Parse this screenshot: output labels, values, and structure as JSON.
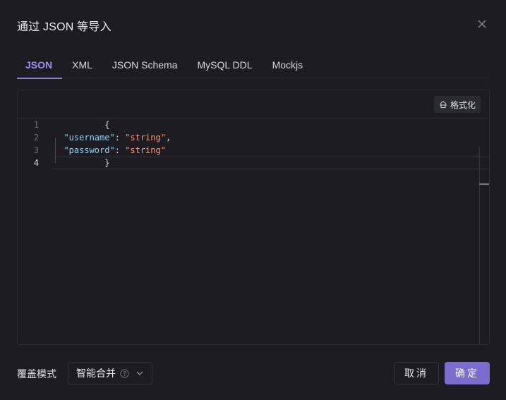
{
  "dialog": {
    "title": "通过 JSON 等导入",
    "close_icon": "close-icon"
  },
  "tabs": [
    {
      "label": "JSON",
      "active": true
    },
    {
      "label": "XML",
      "active": false
    },
    {
      "label": "JSON Schema",
      "active": false
    },
    {
      "label": "MySQL DDL",
      "active": false
    },
    {
      "label": "Mockjs",
      "active": false
    }
  ],
  "editor": {
    "format_button": {
      "label": "格式化",
      "icon": "format-icon"
    },
    "lines": [
      {
        "number": "1",
        "tokens": [
          {
            "t": "punct",
            "v": "{"
          }
        ]
      },
      {
        "number": "2",
        "tokens": [
          {
            "t": "punct",
            "v": "  "
          },
          {
            "t": "key",
            "v": "\"username\""
          },
          {
            "t": "punct",
            "v": ": "
          },
          {
            "t": "str",
            "v": "\"string\""
          },
          {
            "t": "punct",
            "v": ","
          }
        ]
      },
      {
        "number": "3",
        "tokens": [
          {
            "t": "punct",
            "v": "  "
          },
          {
            "t": "key",
            "v": "\"password\""
          },
          {
            "t": "punct",
            "v": ": "
          },
          {
            "t": "str",
            "v": "\"string\""
          }
        ]
      },
      {
        "number": "4",
        "tokens": [
          {
            "t": "punct",
            "v": "}"
          }
        ]
      }
    ],
    "current_line": "4"
  },
  "footer": {
    "mode_label": "覆盖模式",
    "mode_select": {
      "value": "智能合并",
      "help_icon": "help-circle-icon",
      "chevron_icon": "chevron-down-icon"
    },
    "cancel_label": "取消",
    "confirm_label": "确定"
  },
  "colors": {
    "accent": "#7b6cd0",
    "active_tab": "#a08fe8",
    "background": "#1c1c22",
    "json_key": "#8fd3f7",
    "json_string": "#ec9a7a"
  }
}
